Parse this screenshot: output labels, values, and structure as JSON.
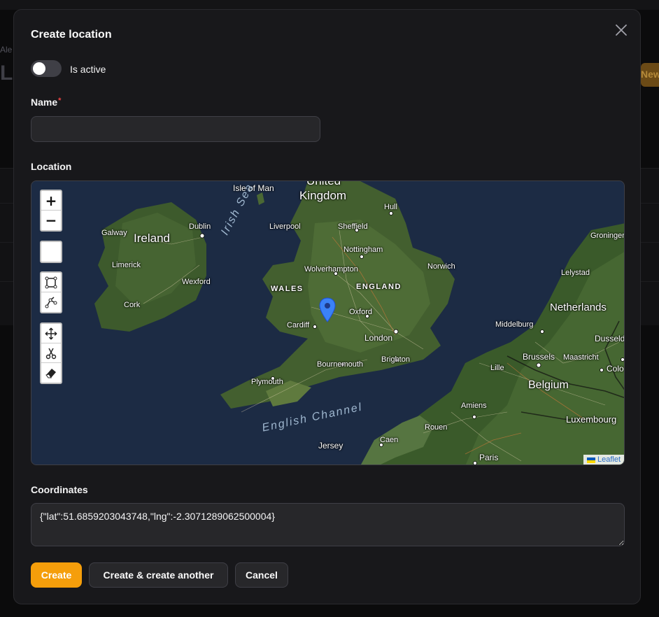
{
  "background": {
    "breadcrumb": "Ale",
    "title_fragment": "Lo",
    "new_button_fragment": "New"
  },
  "modal": {
    "title": "Create location",
    "close_icon": "close-icon",
    "is_active": {
      "label": "Is active",
      "checked": false
    },
    "name": {
      "label": "Name",
      "required_mark": "*",
      "value": "",
      "placeholder": ""
    },
    "location": {
      "label": "Location",
      "map": {
        "labels": {
          "united_kingdom_top": "United",
          "united_kingdom": "Kingdom",
          "isle_of_man": "Isle of Man",
          "ireland": "Ireland",
          "galway": "Galway",
          "dublin": "Dublin",
          "limerick": "Limerick",
          "wexford": "Wexford",
          "cork": "Cork",
          "irish_sea": "Irish Sea",
          "hull": "Hull",
          "liverpool": "Liverpool",
          "sheffield": "Sheffield",
          "nottingham": "Nottingham",
          "wolverhampton": "Wolverhampton",
          "norwich": "Norwich",
          "wales": "WALES",
          "england": "ENGLAND",
          "oxford": "Oxford",
          "cardiff": "Cardiff",
          "london": "London",
          "brighton": "Brighton",
          "bournemouth": "Bournemouth",
          "plymouth": "Plymouth",
          "english_channel": "English Channel",
          "jersey": "Jersey",
          "caen": "Caen",
          "rouen": "Rouen",
          "paris": "Paris",
          "amiens": "Amiens",
          "lille": "Lille",
          "belgium": "Belgium",
          "brussels": "Brussels",
          "maastricht": "Maastricht",
          "luxembourg": "Luxembourg",
          "netherlands": "Netherlands",
          "middelburg": "Middelburg",
          "lelystad": "Lelystad",
          "groningen": "Groningen",
          "dusseldorf": "Dusseld",
          "cologne": "Colo"
        },
        "zoom_in": "+",
        "zoom_out": "−",
        "attribution": "Leaflet",
        "marker_icon": "map-marker-icon",
        "tools": [
          "draw-polygon-icon",
          "draw-polyline-icon",
          "move-icon",
          "cut-icon",
          "eraser-icon"
        ]
      }
    },
    "coordinates": {
      "label": "Coordinates",
      "value": "{\"lat\":51.6859203043748,\"lng\":-2.3071289062500004}"
    },
    "actions": {
      "create": "Create",
      "create_another": "Create & create another",
      "cancel": "Cancel"
    },
    "colors": {
      "primary": "#f59e0b",
      "surface": "#18181b",
      "input": "#27272a",
      "marker": "#3b82f6"
    }
  }
}
